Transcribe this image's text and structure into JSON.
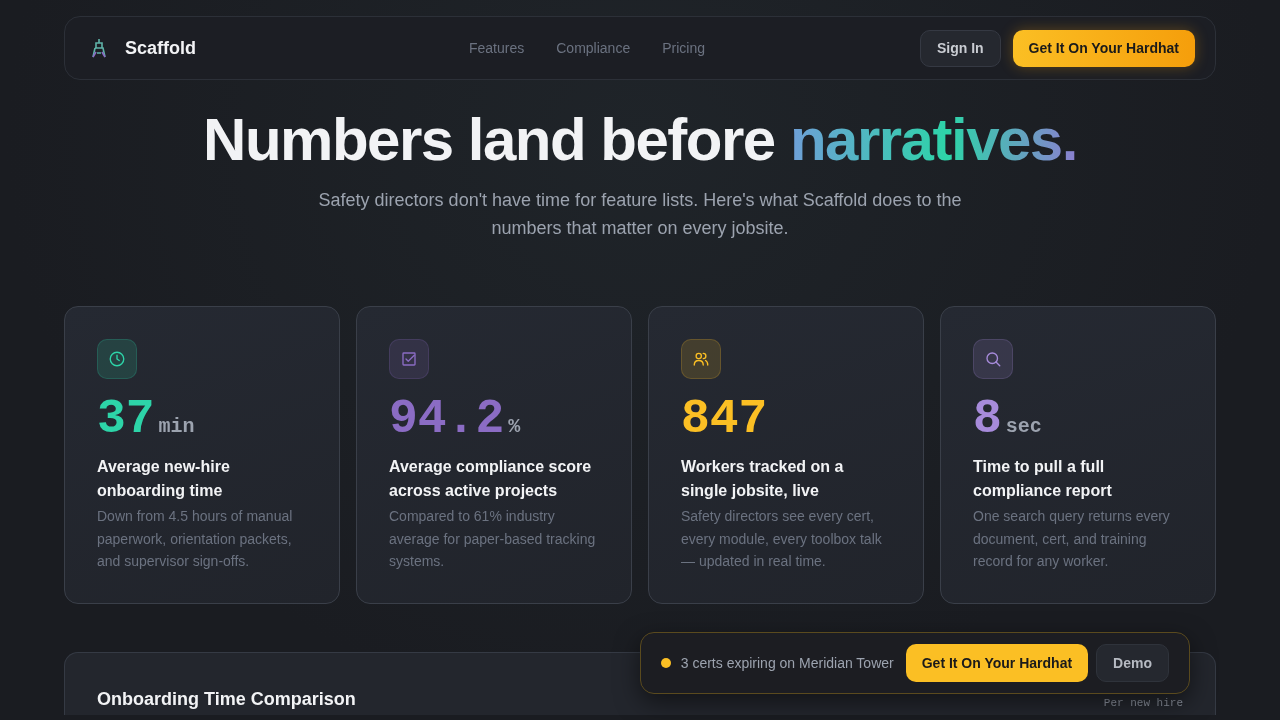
{
  "nav": {
    "brand": "Scaffold",
    "links": [
      "Features",
      "Compliance",
      "Pricing"
    ],
    "sign_in": "Sign In",
    "cta": "Get It On Your Hardhat"
  },
  "hero": {
    "title": "Numbers land before",
    "title_accent": "narratives.",
    "subtitle": "Safety directors don't have time for feature lists. Here's what Scaffold does to the numbers that matter on every jobsite."
  },
  "stats": [
    {
      "kind": "clock",
      "color": "#2dd4a8",
      "value": "37",
      "unit": "min",
      "title": "Average new-hire onboarding time",
      "description": "Down from 4.5 hours of manual paperwork, orientation packets, and supervisor sign-offs."
    },
    {
      "kind": "check",
      "color": "#8b6cc4",
      "value": "94.2",
      "unit": "%",
      "title": "Average compliance score across active projects",
      "description": "Compared to 61% industry average for paper-based tracking systems."
    },
    {
      "kind": "people",
      "color": "#fbbf24",
      "value": "847",
      "title": "Workers tracked on a single jobsite, live",
      "description": "Safety directors see every cert, every module, every toolbox talk — updated in real time."
    },
    {
      "kind": "search",
      "color": "#a78bdb",
      "value": "8",
      "unit": "sec",
      "title": "Time to pull a full compliance report",
      "description": "One search query returns every document, cert, and training record for any worker."
    }
  ],
  "comparison": {
    "title": "Onboarding Time Comparison",
    "note": "Per new hire"
  },
  "toast": {
    "message": "3 certs expiring on Meridian Tower",
    "cta": "Get It On Your Hardhat",
    "demo": "Demo"
  }
}
